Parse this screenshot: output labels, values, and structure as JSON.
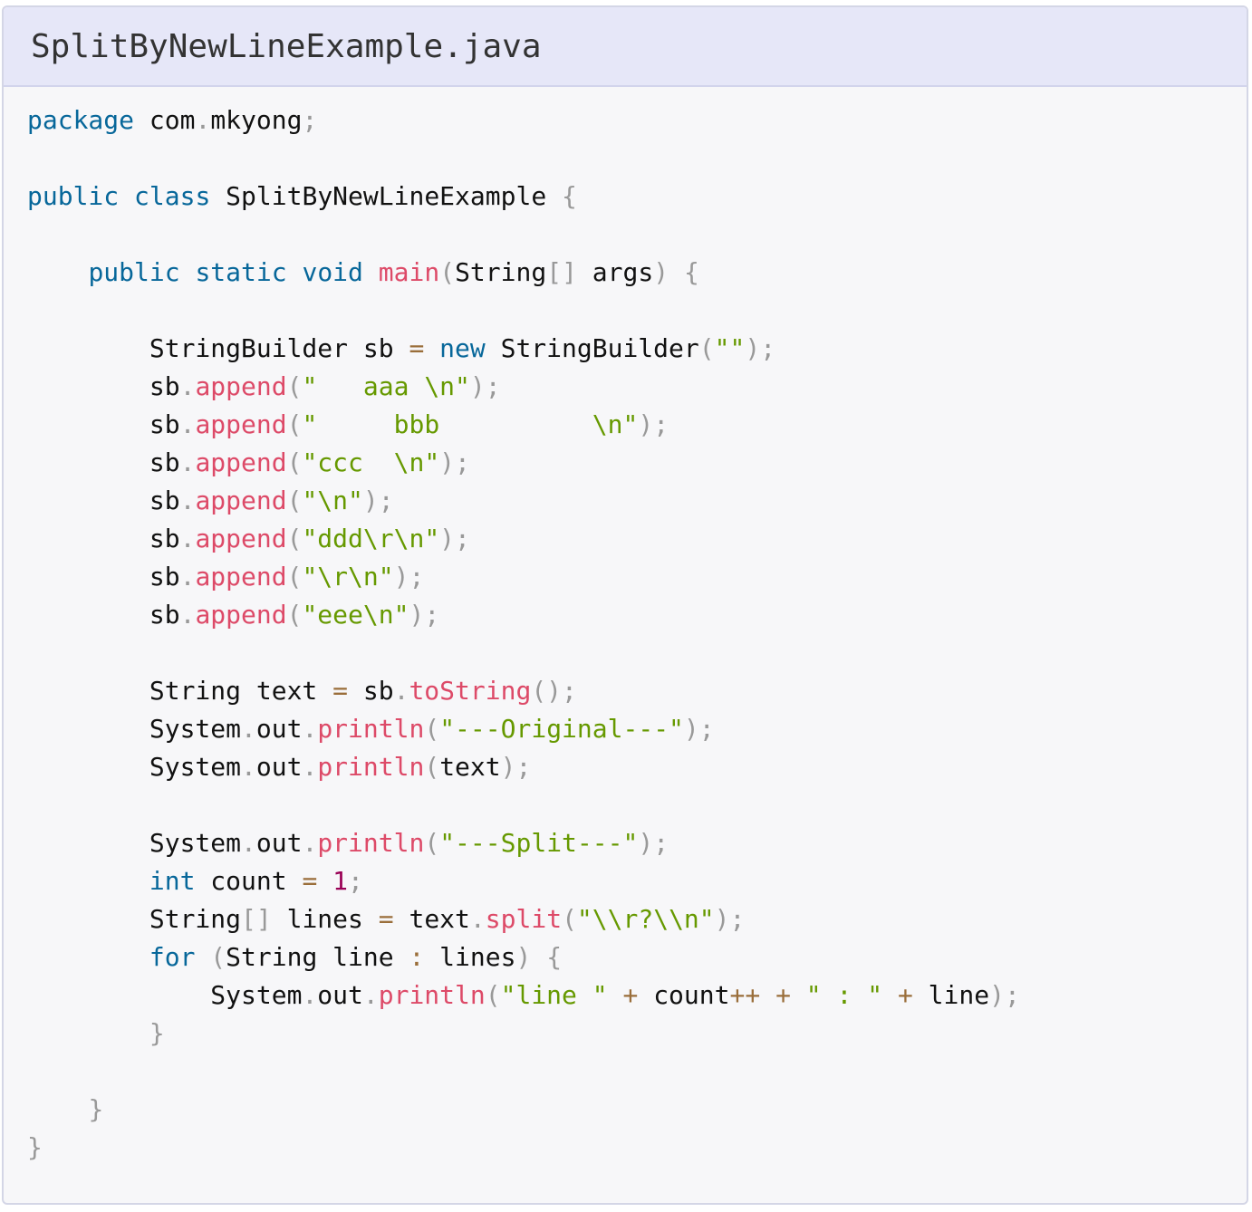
{
  "file": {
    "name": "SplitByNewLineExample.java"
  },
  "colors": {
    "header_bg": "#e6e7f8",
    "code_bg": "#f7f7f9",
    "keyword": "#07679a",
    "function": "#dd4a68",
    "string": "#669900",
    "number": "#990055",
    "punctuation": "#999999",
    "text": "#111111"
  },
  "code": {
    "lines": [
      [
        [
          "kw",
          "package"
        ],
        [
          "txt",
          " com"
        ],
        [
          "punc",
          "."
        ],
        [
          "txt",
          "mkyong"
        ],
        [
          "punc",
          ";"
        ]
      ],
      [],
      [
        [
          "kw",
          "public"
        ],
        [
          "txt",
          " "
        ],
        [
          "kw",
          "class"
        ],
        [
          "txt",
          " SplitByNewLineExample "
        ],
        [
          "punc",
          "{"
        ]
      ],
      [],
      [
        [
          "txt",
          "    "
        ],
        [
          "kw",
          "public"
        ],
        [
          "txt",
          " "
        ],
        [
          "kw",
          "static"
        ],
        [
          "txt",
          " "
        ],
        [
          "kw",
          "void"
        ],
        [
          "txt",
          " "
        ],
        [
          "fn",
          "main"
        ],
        [
          "punc",
          "("
        ],
        [
          "txt",
          "String"
        ],
        [
          "punc",
          "[]"
        ],
        [
          "txt",
          " args"
        ],
        [
          "punc",
          ")"
        ],
        [
          "txt",
          " "
        ],
        [
          "punc",
          "{"
        ]
      ],
      [],
      [
        [
          "txt",
          "        StringBuilder sb "
        ],
        [
          "op",
          "="
        ],
        [
          "txt",
          " "
        ],
        [
          "kw",
          "new"
        ],
        [
          "txt",
          " StringBuilder"
        ],
        [
          "punc",
          "("
        ],
        [
          "str",
          "\"\""
        ],
        [
          "punc",
          ")"
        ],
        [
          "punc",
          ";"
        ]
      ],
      [
        [
          "txt",
          "        sb"
        ],
        [
          "punc",
          "."
        ],
        [
          "fn",
          "append"
        ],
        [
          "punc",
          "("
        ],
        [
          "str",
          "\"   aaa \\n\""
        ],
        [
          "punc",
          ")"
        ],
        [
          "punc",
          ";"
        ]
      ],
      [
        [
          "txt",
          "        sb"
        ],
        [
          "punc",
          "."
        ],
        [
          "fn",
          "append"
        ],
        [
          "punc",
          "("
        ],
        [
          "str",
          "\"     bbb          \\n\""
        ],
        [
          "punc",
          ")"
        ],
        [
          "punc",
          ";"
        ]
      ],
      [
        [
          "txt",
          "        sb"
        ],
        [
          "punc",
          "."
        ],
        [
          "fn",
          "append"
        ],
        [
          "punc",
          "("
        ],
        [
          "str",
          "\"ccc  \\n\""
        ],
        [
          "punc",
          ")"
        ],
        [
          "punc",
          ";"
        ]
      ],
      [
        [
          "txt",
          "        sb"
        ],
        [
          "punc",
          "."
        ],
        [
          "fn",
          "append"
        ],
        [
          "punc",
          "("
        ],
        [
          "str",
          "\"\\n\""
        ],
        [
          "punc",
          ")"
        ],
        [
          "punc",
          ";"
        ]
      ],
      [
        [
          "txt",
          "        sb"
        ],
        [
          "punc",
          "."
        ],
        [
          "fn",
          "append"
        ],
        [
          "punc",
          "("
        ],
        [
          "str",
          "\"ddd\\r\\n\""
        ],
        [
          "punc",
          ")"
        ],
        [
          "punc",
          ";"
        ]
      ],
      [
        [
          "txt",
          "        sb"
        ],
        [
          "punc",
          "."
        ],
        [
          "fn",
          "append"
        ],
        [
          "punc",
          "("
        ],
        [
          "str",
          "\"\\r\\n\""
        ],
        [
          "punc",
          ")"
        ],
        [
          "punc",
          ";"
        ]
      ],
      [
        [
          "txt",
          "        sb"
        ],
        [
          "punc",
          "."
        ],
        [
          "fn",
          "append"
        ],
        [
          "punc",
          "("
        ],
        [
          "str",
          "\"eee\\n\""
        ],
        [
          "punc",
          ")"
        ],
        [
          "punc",
          ";"
        ]
      ],
      [],
      [
        [
          "txt",
          "        String text "
        ],
        [
          "op",
          "="
        ],
        [
          "txt",
          " sb"
        ],
        [
          "punc",
          "."
        ],
        [
          "fn",
          "toString"
        ],
        [
          "punc",
          "()"
        ],
        [
          "punc",
          ";"
        ]
      ],
      [
        [
          "txt",
          "        System"
        ],
        [
          "punc",
          "."
        ],
        [
          "txt",
          "out"
        ],
        [
          "punc",
          "."
        ],
        [
          "fn",
          "println"
        ],
        [
          "punc",
          "("
        ],
        [
          "str",
          "\"---Original---\""
        ],
        [
          "punc",
          ")"
        ],
        [
          "punc",
          ";"
        ]
      ],
      [
        [
          "txt",
          "        System"
        ],
        [
          "punc",
          "."
        ],
        [
          "txt",
          "out"
        ],
        [
          "punc",
          "."
        ],
        [
          "fn",
          "println"
        ],
        [
          "punc",
          "("
        ],
        [
          "txt",
          "text"
        ],
        [
          "punc",
          ")"
        ],
        [
          "punc",
          ";"
        ]
      ],
      [],
      [
        [
          "txt",
          "        System"
        ],
        [
          "punc",
          "."
        ],
        [
          "txt",
          "out"
        ],
        [
          "punc",
          "."
        ],
        [
          "fn",
          "println"
        ],
        [
          "punc",
          "("
        ],
        [
          "str",
          "\"---Split---\""
        ],
        [
          "punc",
          ")"
        ],
        [
          "punc",
          ";"
        ]
      ],
      [
        [
          "txt",
          "        "
        ],
        [
          "kw",
          "int"
        ],
        [
          "txt",
          " count "
        ],
        [
          "op",
          "="
        ],
        [
          "txt",
          " "
        ],
        [
          "num",
          "1"
        ],
        [
          "punc",
          ";"
        ]
      ],
      [
        [
          "txt",
          "        String"
        ],
        [
          "punc",
          "[]"
        ],
        [
          "txt",
          " lines "
        ],
        [
          "op",
          "="
        ],
        [
          "txt",
          " text"
        ],
        [
          "punc",
          "."
        ],
        [
          "fn",
          "split"
        ],
        [
          "punc",
          "("
        ],
        [
          "str",
          "\"\\\\r?\\\\n\""
        ],
        [
          "punc",
          ")"
        ],
        [
          "punc",
          ";"
        ]
      ],
      [
        [
          "txt",
          "        "
        ],
        [
          "kw",
          "for"
        ],
        [
          "txt",
          " "
        ],
        [
          "punc",
          "("
        ],
        [
          "txt",
          "String line "
        ],
        [
          "op",
          ":"
        ],
        [
          "txt",
          " lines"
        ],
        [
          "punc",
          ")"
        ],
        [
          "txt",
          " "
        ],
        [
          "punc",
          "{"
        ]
      ],
      [
        [
          "txt",
          "            System"
        ],
        [
          "punc",
          "."
        ],
        [
          "txt",
          "out"
        ],
        [
          "punc",
          "."
        ],
        [
          "fn",
          "println"
        ],
        [
          "punc",
          "("
        ],
        [
          "str",
          "\"line \""
        ],
        [
          "txt",
          " "
        ],
        [
          "op",
          "+"
        ],
        [
          "txt",
          " count"
        ],
        [
          "op",
          "++"
        ],
        [
          "txt",
          " "
        ],
        [
          "op",
          "+"
        ],
        [
          "txt",
          " "
        ],
        [
          "str",
          "\" : \""
        ],
        [
          "txt",
          " "
        ],
        [
          "op",
          "+"
        ],
        [
          "txt",
          " line"
        ],
        [
          "punc",
          ")"
        ],
        [
          "punc",
          ";"
        ]
      ],
      [
        [
          "txt",
          "        "
        ],
        [
          "punc",
          "}"
        ]
      ],
      [],
      [
        [
          "txt",
          "    "
        ],
        [
          "punc",
          "}"
        ]
      ],
      [
        [
          "punc",
          "}"
        ]
      ]
    ]
  }
}
